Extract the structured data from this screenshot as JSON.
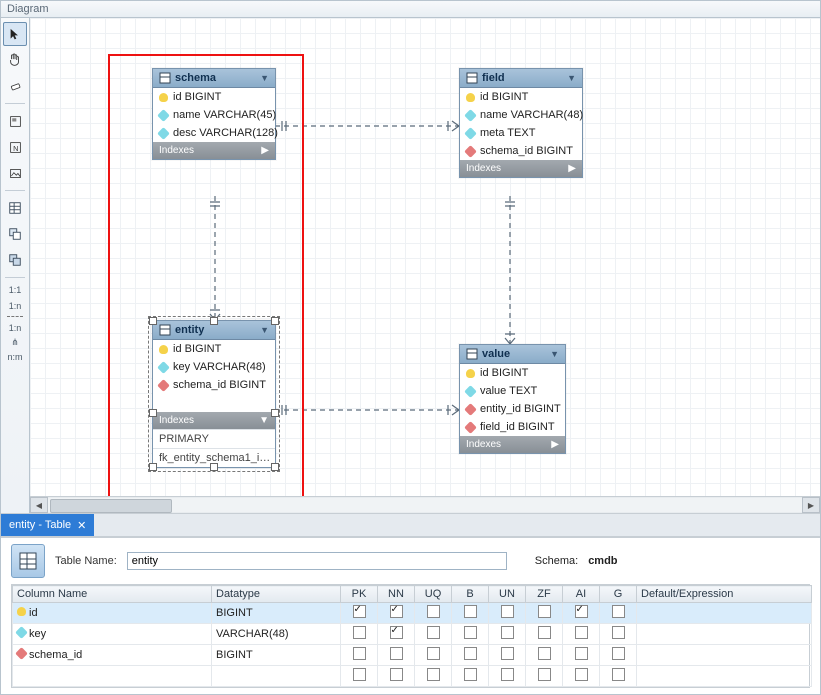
{
  "title": "Diagram",
  "toolbar": {
    "relations": [
      "1:1",
      "1:n",
      "1:n",
      "n:m"
    ]
  },
  "tables": {
    "schema": {
      "name": "schema",
      "cols": [
        {
          "icon": "key",
          "text": "id BIGINT"
        },
        {
          "icon": "blue",
          "text": "name VARCHAR(45)"
        },
        {
          "icon": "blue",
          "text": "desc VARCHAR(128)"
        }
      ],
      "idxhdr": "Indexes"
    },
    "field": {
      "name": "field",
      "cols": [
        {
          "icon": "key",
          "text": "id BIGINT"
        },
        {
          "icon": "blue",
          "text": "name VARCHAR(48)"
        },
        {
          "icon": "blue",
          "text": "meta TEXT"
        },
        {
          "icon": "red",
          "text": "schema_id BIGINT"
        }
      ],
      "idxhdr": "Indexes"
    },
    "entity": {
      "name": "entity",
      "cols": [
        {
          "icon": "key",
          "text": "id BIGINT"
        },
        {
          "icon": "blue",
          "text": "key VARCHAR(48)"
        },
        {
          "icon": "red",
          "text": "schema_id BIGINT"
        }
      ],
      "idxhdr": "Indexes",
      "idxrows": [
        "PRIMARY",
        "fk_entity_schema1_i…"
      ]
    },
    "value": {
      "name": "value",
      "cols": [
        {
          "icon": "key",
          "text": "id BIGINT"
        },
        {
          "icon": "blue",
          "text": "value TEXT"
        },
        {
          "icon": "red",
          "text": "entity_id BIGINT"
        },
        {
          "icon": "red",
          "text": "field_id BIGINT"
        }
      ],
      "idxhdr": "Indexes"
    }
  },
  "tab": {
    "label": "entity - Table"
  },
  "editor": {
    "table_name_label": "Table Name:",
    "table_name_value": "entity",
    "schema_label": "Schema:",
    "schema_value": "cmdb",
    "headers": {
      "col": "Column Name",
      "dt": "Datatype",
      "pk": "PK",
      "nn": "NN",
      "uq": "UQ",
      "b": "B",
      "un": "UN",
      "zf": "ZF",
      "ai": "AI",
      "g": "G",
      "def": "Default/Expression"
    },
    "rows": [
      {
        "icon": "key",
        "name": "id",
        "dt": "BIGINT",
        "pk": true,
        "nn": true,
        "uq": false,
        "b": false,
        "un": false,
        "zf": false,
        "ai": true,
        "g": false,
        "def": ""
      },
      {
        "icon": "blue",
        "name": "key",
        "dt": "VARCHAR(48)",
        "pk": false,
        "nn": true,
        "uq": false,
        "b": false,
        "un": false,
        "zf": false,
        "ai": false,
        "g": false,
        "def": ""
      },
      {
        "icon": "red",
        "name": "schema_id",
        "dt": "BIGINT",
        "pk": false,
        "nn": false,
        "uq": false,
        "b": false,
        "un": false,
        "zf": false,
        "ai": false,
        "g": false,
        "def": ""
      }
    ]
  }
}
